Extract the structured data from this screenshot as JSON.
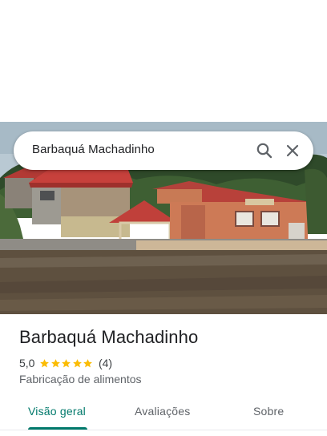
{
  "search": {
    "query": "Barbaquá Machadinho",
    "search_icon": "search-icon",
    "close_icon": "close-icon"
  },
  "photo": {
    "subject": "place-photo"
  },
  "place": {
    "name": "Barbaquá Machadinho",
    "rating": "5,0",
    "stars": 5,
    "reviews": "(4)",
    "category": "Fabricação de alimentos"
  },
  "tabs": [
    {
      "label": "Visão geral",
      "active": true
    },
    {
      "label": "Avaliações",
      "active": false
    },
    {
      "label": "Sobre",
      "active": false
    }
  ],
  "colors": {
    "accent": "#00796b",
    "star": "#fbbc04"
  }
}
